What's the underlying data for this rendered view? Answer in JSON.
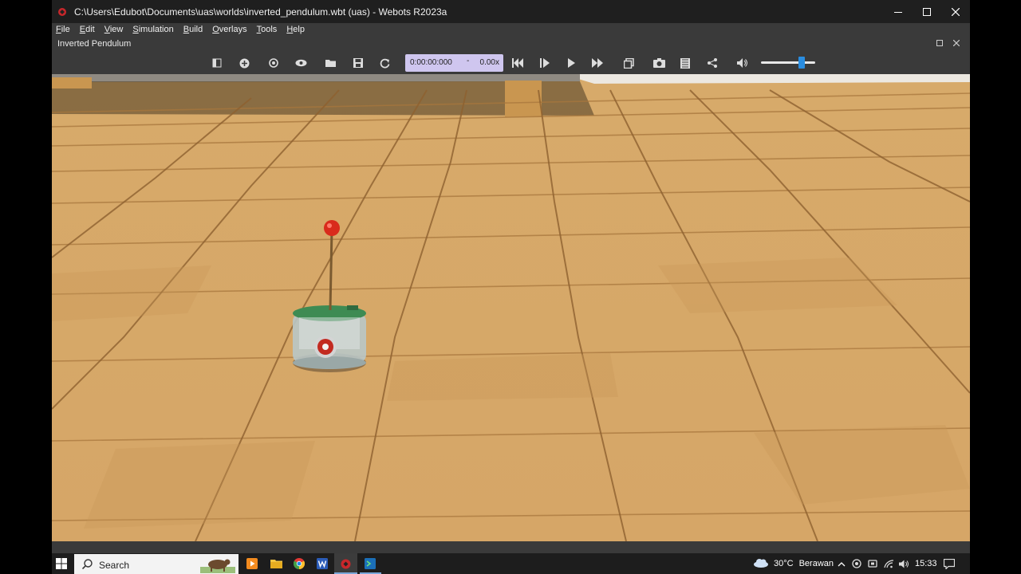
{
  "window": {
    "title": "C:\\Users\\Edubot\\Documents\\uas\\worlds\\inverted_pendulum.wbt (uas) - Webots R2023a",
    "app_icon": "webots-icon"
  },
  "menu": [
    "File",
    "Edit",
    "View",
    "Simulation",
    "Build",
    "Overlays",
    "Tools",
    "Help"
  ],
  "panel": {
    "title": "Inverted Pendulum"
  },
  "toolbar": {
    "time": "0:00:00:000",
    "time_separator": "-",
    "speed": "0.00x",
    "volume_level": 0.75
  },
  "taskbar": {
    "search_placeholder": "Search",
    "weather_temp": "30°C",
    "weather_desc": "Berawan",
    "clock": "15:33"
  },
  "colors": {
    "timebox_bg": "#cfc6ef",
    "slider_accent": "#2a8de0",
    "floor_wood": "#d9a866",
    "pendulum_ball": "#d92b1c"
  }
}
